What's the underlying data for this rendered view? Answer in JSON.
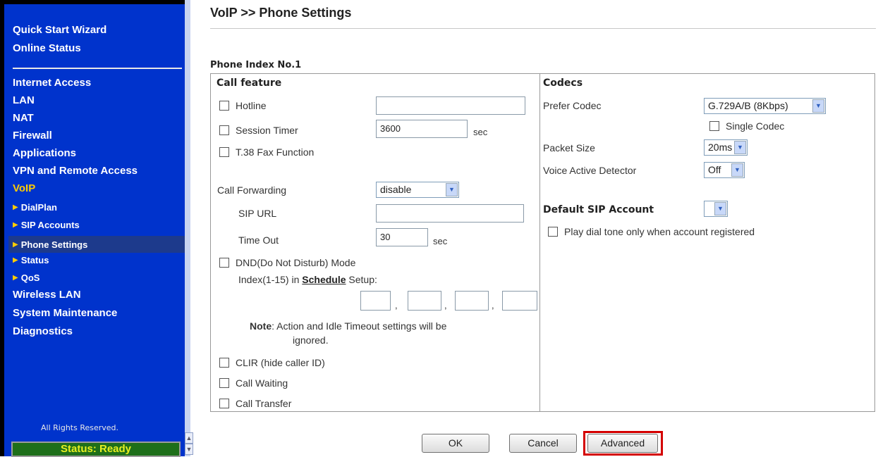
{
  "sidebar": {
    "top_items": [
      "Quick Start Wizard",
      "Online Status"
    ],
    "items": [
      "Internet Access",
      "LAN",
      "NAT",
      "Firewall",
      "Applications",
      "VPN and Remote Access",
      "VoIP"
    ],
    "voip_sub": [
      "DialPlan",
      "SIP Accounts",
      "Phone Settings",
      "Status",
      "QoS"
    ],
    "bottom_items": [
      "Wireless LAN",
      "System Maintenance",
      "Diagnostics"
    ],
    "rights": "All Rights Reserved.",
    "status": "Status: Ready"
  },
  "page": {
    "title": "VoIP >> Phone Settings",
    "phone_index": "Phone Index No.1"
  },
  "call_feature": {
    "header": "Call feature",
    "hotline": "Hotline",
    "session_timer": "Session Timer",
    "session_timer_value": "3600",
    "sec": "sec",
    "t38": "T.38 Fax Function",
    "call_forwarding": "Call Forwarding",
    "call_forwarding_value": "disable",
    "sip_url": "SIP URL",
    "time_out": "Time Out",
    "time_out_value": "30",
    "dnd": "DND(Do Not Disturb) Mode",
    "index_prefix": "Index(1-15) in",
    "schedule": "Schedule",
    "index_suffix": "Setup:",
    "comma": ",",
    "note_label": "Note",
    "note_text": ":  Action and Idle Timeout settings will be",
    "note_text2": "ignored.",
    "clir": "CLIR (hide caller ID)",
    "call_waiting": "Call Waiting",
    "call_transfer": "Call Transfer"
  },
  "codecs": {
    "header": "Codecs",
    "prefer_codec": "Prefer Codec",
    "prefer_codec_value": "G.729A/B (8Kbps)",
    "single_codec": "Single Codec",
    "packet_size": "Packet Size",
    "packet_size_value": "20ms",
    "vad": "Voice Active Detector",
    "vad_value": "Off",
    "default_sip": "Default SIP Account",
    "play_dial_tone": "Play dial tone only when account registered"
  },
  "buttons": {
    "ok": "OK",
    "cancel": "Cancel",
    "advanced": "Advanced"
  },
  "colors": {
    "sidebar_bg": "#0033cc",
    "active_nav": "#ffcc00",
    "highlight": "#d40000",
    "status_bg": "#1e6f1a"
  }
}
